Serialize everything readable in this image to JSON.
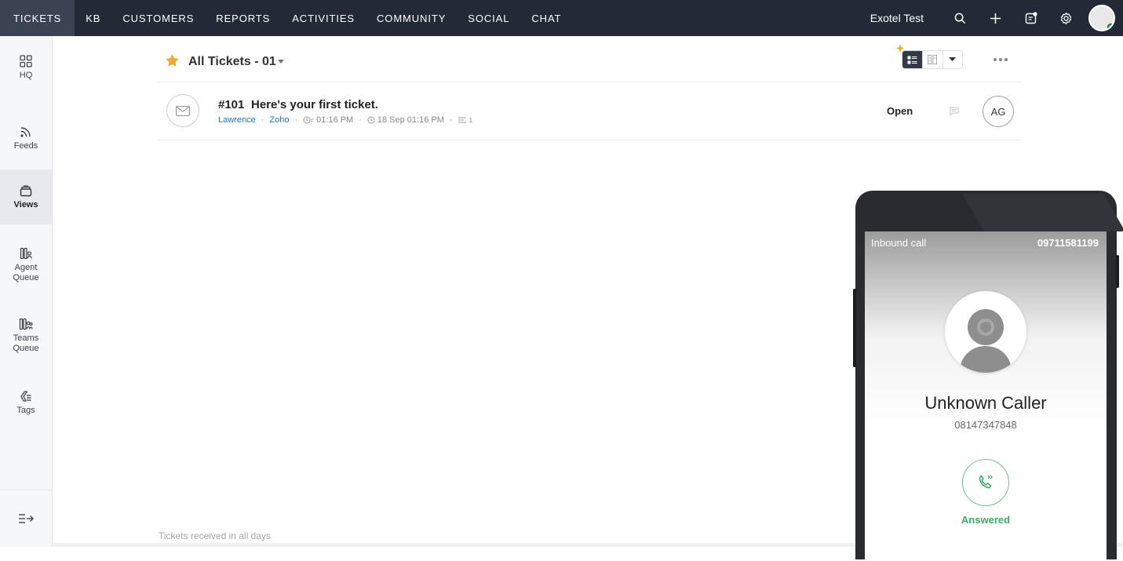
{
  "nav": {
    "tabs": [
      "TICKETS",
      "KB",
      "CUSTOMERS",
      "REPORTS",
      "ACTIVITIES",
      "COMMUNITY",
      "SOCIAL",
      "CHAT"
    ],
    "org_name": "Exotel Test"
  },
  "sidebar": {
    "items": [
      {
        "label": "HQ",
        "icon": "grid-icon"
      },
      {
        "label": "Feeds",
        "icon": "feeds-icon"
      },
      {
        "label": "Views",
        "icon": "views-icon"
      },
      {
        "label": "Agent\nQueue",
        "icon": "agent-queue-icon"
      },
      {
        "label": "Teams\nQueue",
        "icon": "teams-queue-icon"
      },
      {
        "label": "Tags",
        "icon": "tags-icon"
      }
    ],
    "active": "Views"
  },
  "view": {
    "title": "All Tickets - 01"
  },
  "ticket": {
    "number": "#101",
    "subject": "Here's your first ticket.",
    "contact": "Lawrence",
    "account": "Zoho",
    "response_time": "01:16 PM",
    "created": "18 Sep 01:16 PM",
    "thread_count": "1",
    "status": "Open",
    "assignee_initials": "AG"
  },
  "footer": {
    "note": "Tickets received in all days"
  },
  "phone": {
    "call_type": "Inbound call",
    "called_number": "09711581199",
    "caller_name": "Unknown Caller",
    "caller_number": "08147347848",
    "call_status": "Answered"
  },
  "colors": {
    "topbar": "#232a36",
    "link": "#1a78c2",
    "star": "#f2a933",
    "answered": "#3cae63"
  }
}
